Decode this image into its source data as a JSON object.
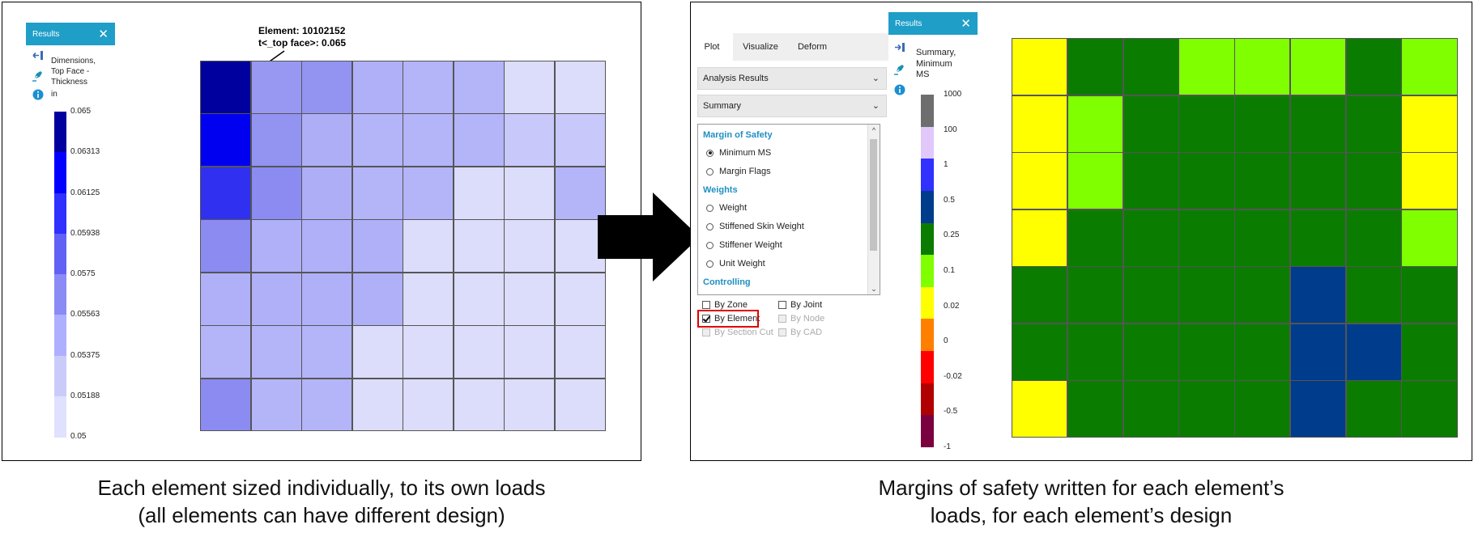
{
  "left_panel": {
    "results_title": "Results",
    "label_lines": [
      "Dimensions,",
      "Top Face -",
      "Thickness",
      "in"
    ],
    "legend_ticks": [
      "0.065",
      "0.06313",
      "0.06125",
      "0.05938",
      "0.0575",
      "0.05563",
      "0.05375",
      "0.05188",
      "0.05"
    ],
    "legend_colors": [
      "#00009e",
      "#0000ff",
      "#3030ff",
      "#6161f5",
      "#8b8bf5",
      "#afafff",
      "#cbcbfa",
      "#e0e0ff"
    ],
    "annotation_line1": "Element: 10102152",
    "annotation_line2": "t<_top face>: 0.065",
    "mesh_cols": 8,
    "mesh_rows": 7,
    "mesh_colors": [
      [
        "#00009e",
        "#9898f3",
        "#9393f2",
        "#b0b0f8",
        "#b4b4f8",
        "#b4b4f8",
        "#dcdcfb",
        "#dcdcfb"
      ],
      [
        "#0000f0",
        "#9393f2",
        "#aeaef7",
        "#b4b4f8",
        "#b4b4f8",
        "#b4b4f8",
        "#c8c8fa",
        "#c8c8fa"
      ],
      [
        "#3030f0",
        "#8b8bf2",
        "#aeaef7",
        "#b4b4f8",
        "#b4b4f8",
        "#dcdcfb",
        "#dcdcfb",
        "#b4b4f8"
      ],
      [
        "#8b8bf2",
        "#b0b0f8",
        "#b0b0f8",
        "#b0b0f8",
        "#dcdcfb",
        "#dcdcfb",
        "#dcdcfb",
        "#dcdcfb"
      ],
      [
        "#b0b0f8",
        "#b0b0f8",
        "#b0b0f8",
        "#b0b0f8",
        "#dcdcfb",
        "#dcdcfb",
        "#dcdcfb",
        "#dcdcfb"
      ],
      [
        "#b4b4f8",
        "#b4b4f8",
        "#b4b4f8",
        "#dcdcfb",
        "#dcdcfb",
        "#dcdcfb",
        "#dcdcfb",
        "#dcdcfb"
      ],
      [
        "#8b8bf2",
        "#b4b4f8",
        "#b4b4f8",
        "#dcdcfb",
        "#dcdcfb",
        "#dcdcfb",
        "#dcdcfb",
        "#dcdcfb"
      ]
    ]
  },
  "right_panel": {
    "tabs": [
      "Plot",
      "Visualize",
      "Deform"
    ],
    "active_tab": 0,
    "dropdown_1": "Analysis Results",
    "dropdown_2": "Summary",
    "groups": [
      {
        "header": "Margin of Safety",
        "items": [
          {
            "label": "Minimum MS",
            "selected": true
          },
          {
            "label": "Margin Flags",
            "selected": false
          }
        ]
      },
      {
        "header": "Weights",
        "items": [
          {
            "label": "Weight",
            "selected": false
          },
          {
            "label": "Stiffened Skin Weight",
            "selected": false
          },
          {
            "label": "Stiffener Weight",
            "selected": false
          },
          {
            "label": "Unit Weight",
            "selected": false
          }
        ]
      },
      {
        "header": "Controlling",
        "items": []
      }
    ],
    "checkboxes": [
      {
        "label": "By Zone",
        "checked": false,
        "enabled": true
      },
      {
        "label": "By Joint",
        "checked": false,
        "enabled": true
      },
      {
        "label": "By Element",
        "checked": true,
        "enabled": true
      },
      {
        "label": "By Node",
        "checked": false,
        "enabled": false
      },
      {
        "label": "By Section Cut",
        "checked": false,
        "enabled": false
      },
      {
        "label": "By CAD",
        "checked": false,
        "enabled": false
      }
    ],
    "results_title": "Results",
    "label_lines": [
      "Summary,",
      "Minimum",
      "MS"
    ],
    "legend_ticks": [
      "1000",
      "100",
      "1",
      "0.5",
      "0.25",
      "0.1",
      "0.02",
      "0",
      "-0.02",
      "-0.5",
      "-1"
    ],
    "legend_colors": [
      "#6e6e6e",
      "#e0c8fa",
      "#3030ff",
      "#003c8c",
      "#0a7d00",
      "#80ff00",
      "#ffff00",
      "#ff8000",
      "#ff0000",
      "#b00000",
      "#7a0040"
    ],
    "mesh_cols": 8,
    "mesh_rows": 7,
    "mesh_colors": [
      [
        "#ffff00",
        "#0a7d00",
        "#0a7d00",
        "#80ff00",
        "#80ff00",
        "#80ff00",
        "#0a7d00",
        "#80ff00"
      ],
      [
        "#ffff00",
        "#80ff00",
        "#0a7d00",
        "#0a7d00",
        "#0a7d00",
        "#0a7d00",
        "#0a7d00",
        "#ffff00"
      ],
      [
        "#ffff00",
        "#80ff00",
        "#0a7d00",
        "#0a7d00",
        "#0a7d00",
        "#0a7d00",
        "#0a7d00",
        "#ffff00"
      ],
      [
        "#ffff00",
        "#0a7d00",
        "#0a7d00",
        "#0a7d00",
        "#0a7d00",
        "#0a7d00",
        "#0a7d00",
        "#80ff00"
      ],
      [
        "#0a7d00",
        "#0a7d00",
        "#0a7d00",
        "#0a7d00",
        "#0a7d00",
        "#003c8c",
        "#0a7d00",
        "#0a7d00"
      ],
      [
        "#0a7d00",
        "#0a7d00",
        "#0a7d00",
        "#0a7d00",
        "#0a7d00",
        "#003c8c",
        "#003c8c",
        "#0a7d00"
      ],
      [
        "#ffff00",
        "#0a7d00",
        "#0a7d00",
        "#0a7d00",
        "#0a7d00",
        "#003c8c",
        "#0a7d00",
        "#0a7d00"
      ]
    ]
  },
  "captions": {
    "left_line1": "Each element sized individually, to its own loads",
    "left_line2": "(all elements can have different design)",
    "right_line1": "Margins of safety written for each element’s",
    "right_line2": "loads, for each element’s design"
  },
  "colors": {
    "title_bar": "#1f9ec8",
    "section_header": "#1f8fc0",
    "highlight": "#e00000",
    "arrow": "#000000"
  }
}
